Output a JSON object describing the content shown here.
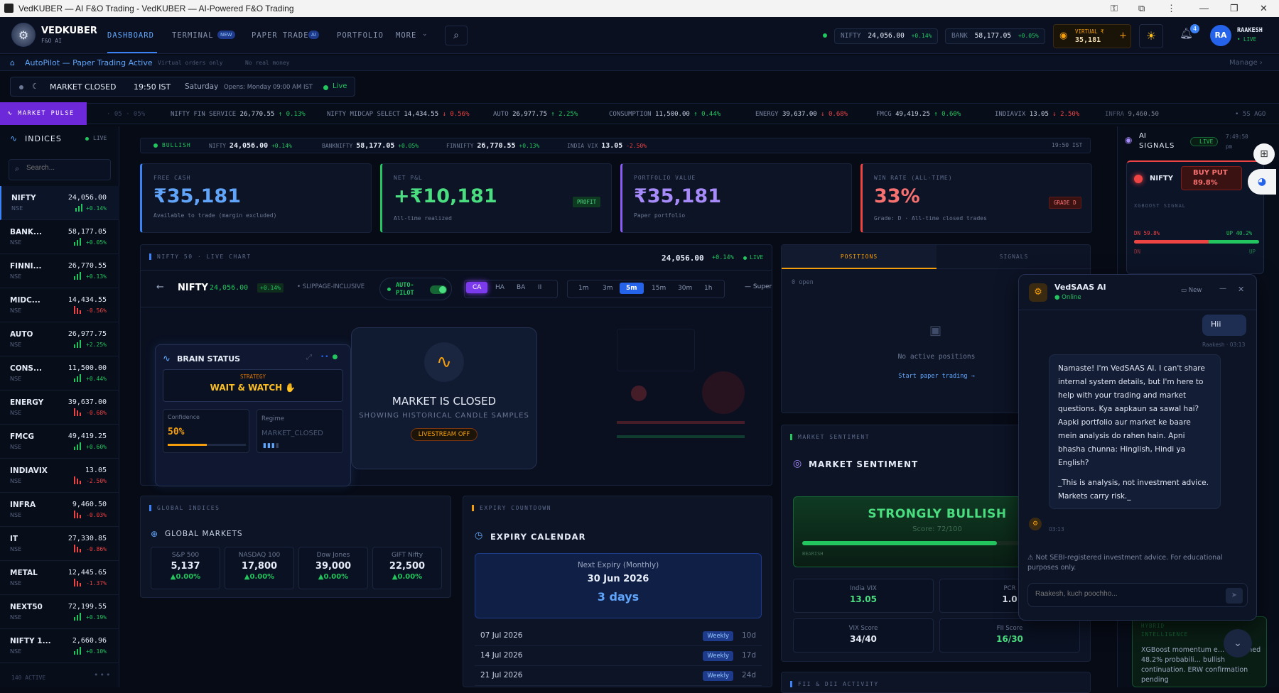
{
  "window": {
    "title": "VedKUBER — AI F&O Trading - VedKUBER — AI-Powered F&O Trading"
  },
  "brand": {
    "name": "VEDKUBER",
    "sub": "F&O AI"
  },
  "nav": {
    "links": [
      "DASHBOARD",
      "TERMINAL",
      "PAPER TRADE",
      "PORTFOLIO",
      "MORE"
    ],
    "terminal_badge": "NEW",
    "paper_badge": "AI",
    "nifty_label": "NIFTY",
    "nifty_value": "24,056.00",
    "nifty_change": "+0.14%",
    "bank_label": "BANK",
    "bank_value": "58,177.05",
    "bank_change": "+0.05%",
    "virtual_label": "VIRTUAL ₹",
    "virtual_value": "35,181",
    "notif_count": "4",
    "avatar": "RA",
    "user_name": "RAAKESH",
    "user_status": "• LIVE"
  },
  "autopilot": {
    "text": "AutoPilot — Paper Trading Active",
    "note1": "Virtual orders only",
    "note2": "No real money",
    "manage": "Manage ›"
  },
  "market_status": {
    "label": "MARKET CLOSED",
    "time": "19:50 IST",
    "day": "Saturday",
    "opens": "Opens: Monday 09:00 AM IST",
    "live": "Live"
  },
  "pulse": {
    "label": "MARKET PULSE",
    "items": [
      {
        "name": "NIFTY FIN SERVICE",
        "value": "26,770.55",
        "change": "↑ 0.13%",
        "dir": "up"
      },
      {
        "name": "NIFTY MIDCAP SELECT",
        "value": "14,434.55",
        "change": "↓ 0.56%",
        "dir": "down"
      },
      {
        "name": "AUTO",
        "value": "26,977.75",
        "change": "↑ 2.25%",
        "dir": "up"
      },
      {
        "name": "CONSUMPTION",
        "value": "11,500.00",
        "change": "↑ 0.44%",
        "dir": "up"
      },
      {
        "name": "ENERGY",
        "value": "39,637.00",
        "change": "↓ 0.68%",
        "dir": "down"
      },
      {
        "name": "FMCG",
        "value": "49,419.25",
        "change": "↑ 0.60%",
        "dir": "up"
      },
      {
        "name": "INDIAVIX",
        "value": "13.05",
        "change": "↓ 2.50%",
        "dir": "down"
      },
      {
        "name": "INFRA",
        "value": "9,460.50",
        "change": "",
        "dir": "up"
      }
    ],
    "ago": "• 5S AGO"
  },
  "indices": {
    "title": "INDICES",
    "live": "LIVE",
    "search_placeholder": "Search...",
    "rows": [
      {
        "name": "NIFTY",
        "ex": "NSE",
        "price": "24,056.00",
        "change": "+0.14%",
        "dir": "up"
      },
      {
        "name": "BANK...",
        "ex": "NSE",
        "price": "58,177.05",
        "change": "+0.05%",
        "dir": "up"
      },
      {
        "name": "FINNI...",
        "ex": "NSE",
        "price": "26,770.55",
        "change": "+0.13%",
        "dir": "up"
      },
      {
        "name": "MIDC...",
        "ex": "NSE",
        "price": "14,434.55",
        "change": "-0.56%",
        "dir": "down"
      },
      {
        "name": "AUTO",
        "ex": "NSE",
        "price": "26,977.75",
        "change": "+2.25%",
        "dir": "up"
      },
      {
        "name": "CONS...",
        "ex": "NSE",
        "price": "11,500.00",
        "change": "+0.44%",
        "dir": "up"
      },
      {
        "name": "ENERGY",
        "ex": "NSE",
        "price": "39,637.00",
        "change": "-0.68%",
        "dir": "down"
      },
      {
        "name": "FMCG",
        "ex": "NSE",
        "price": "49,419.25",
        "change": "+0.60%",
        "dir": "up"
      },
      {
        "name": "INDIAVIX",
        "ex": "NSE",
        "price": "13.05",
        "change": "-2.50%",
        "dir": "down"
      },
      {
        "name": "INFRA",
        "ex": "NSE",
        "price": "9,460.50",
        "change": "-0.03%",
        "dir": "down"
      },
      {
        "name": "IT",
        "ex": "NSE",
        "price": "27,330.85",
        "change": "-0.86%",
        "dir": "down"
      },
      {
        "name": "METAL",
        "ex": "NSE",
        "price": "12,445.65",
        "change": "-1.37%",
        "dir": "down"
      },
      {
        "name": "NEXT50",
        "ex": "NSE",
        "price": "72,199.55",
        "change": "+0.19%",
        "dir": "up"
      },
      {
        "name": "NIFTY 1...",
        "ex": "NSE",
        "price": "2,660.96",
        "change": "+0.10%",
        "dir": "up"
      }
    ],
    "footer": "140 ACTIVE"
  },
  "strip": {
    "bull": "BULLISH",
    "items": [
      {
        "name": "NIFTY",
        "value": "24,056.00",
        "change": "+0.14%",
        "dir": "up"
      },
      {
        "name": "BANKNIFTY",
        "value": "58,177.05",
        "change": "+0.05%",
        "dir": "up"
      },
      {
        "name": "FINNIFTY",
        "value": "26,770.55",
        "change": "+0.13%",
        "dir": "up"
      },
      {
        "name": "INDIA VIX",
        "value": "13.05",
        "change": "-2.50%",
        "dir": "down"
      }
    ],
    "time": "19:50 IST"
  },
  "cards": {
    "free_cash": {
      "label": "FREE CASH",
      "value": "₹35,181",
      "sub": "Available to trade (margin excluded)"
    },
    "net_pnl": {
      "label": "NET P&L",
      "value": "+₹10,181",
      "sub": "All-time realized",
      "badge": "PROFIT"
    },
    "portfolio": {
      "label": "PORTFOLIO VALUE",
      "value": "₹35,181",
      "sub": "Paper portfolio"
    },
    "win_rate": {
      "label": "WIN RATE (ALL-TIME)",
      "value": "33%",
      "sub": "Grade: D · All-time closed trades",
      "badge": "GRADE D"
    }
  },
  "chart": {
    "tag": "NIFTY 50 · LIVE CHART",
    "price": "24,056.00",
    "change": "+0.14%",
    "live": "LIVE",
    "symbol": "NIFTY",
    "sym_price": "24,056.00",
    "sym_change": "+0.14%",
    "slippage": "• SLIPPAGE-INCLUSIVE",
    "auto": "AUTO-",
    "pilot": "PILOT",
    "types": [
      "CA",
      "HA",
      "BA",
      "II"
    ],
    "tfs": [
      "1m",
      "3m",
      "5m",
      "15m",
      "30m",
      "1h"
    ],
    "super": "— Super",
    "closed_title": "MARKET IS CLOSED",
    "closed_sub": "SHOWING HISTORICAL CANDLE SAMPLES",
    "livestream": "LIVESTREAM OFF"
  },
  "brain": {
    "title": "BRAIN STATUS",
    "strategy_label": "STRATEGY",
    "strategy": "WAIT & WATCH ✋",
    "conf_label": "Confidence",
    "conf": "50%",
    "conf_fraction": 0.5,
    "regime_label": "Regime",
    "regime": "MARKET_CLOSED"
  },
  "positions": {
    "tabs": [
      "POSITIONS",
      "SIGNALS"
    ],
    "open": "0 open",
    "empty": "No active positions",
    "start": "Start paper trading →"
  },
  "sentiment": {
    "tag": "MARKET SENTIMENT",
    "title": "MARKET SENTIMENT",
    "verdict": "STRONGLY BULLISH",
    "score": "Score: 72/100",
    "score_fraction": 0.72,
    "bearish": "BEARISH",
    "stats": [
      {
        "label": "India VIX",
        "value": "13.05"
      },
      {
        "label": "PCR",
        "value": "1.0"
      },
      {
        "label": "VIX Score",
        "value": "34/40"
      },
      {
        "label": "FII Score",
        "value": "16/30"
      }
    ],
    "fii_tag": "FII & DII ACTIVITY"
  },
  "global": {
    "tag": "GLOBAL INDICES",
    "title": "GLOBAL MARKETS",
    "items": [
      {
        "name": "S&P 500",
        "value": "5,137",
        "change": "▲0.00%"
      },
      {
        "name": "NASDAQ 100",
        "value": "17,800",
        "change": "▲0.00%"
      },
      {
        "name": "Dow Jones",
        "value": "39,000",
        "change": "▲0.00%"
      },
      {
        "name": "GIFT Nifty",
        "value": "22,500",
        "change": "▲0.00%"
      }
    ]
  },
  "expiry": {
    "tag": "EXPIRY COUNTDOWN",
    "title": "EXPIRY CALENDAR",
    "next_label": "Next Expiry (Monthly)",
    "next_date": "30 Jun 2026",
    "days": "3 days",
    "rows": [
      {
        "date": "07 Jul 2026",
        "type": "Weekly",
        "days": "10d"
      },
      {
        "date": "14 Jul 2026",
        "type": "Weekly",
        "days": "17d"
      },
      {
        "date": "21 Jul 2026",
        "type": "Weekly",
        "days": "24d"
      }
    ]
  },
  "ai_signals": {
    "title1": "AI",
    "title2": "SIGNALS",
    "live": "LIVE",
    "time": "7:49:50",
    "ampm": "pm",
    "sym": "NIFTY",
    "action": "BUY PUT",
    "prob": "89.8%",
    "model": "XGBOOST SIGNAL",
    "dn": "DN 59.8%",
    "up": "UP 40.2%",
    "dn_s": "DN",
    "up_s": "UP",
    "dn_fraction": 0.598,
    "hybrid_title1": "HYBRID",
    "hybrid_title2": "INTELLIGENCE",
    "hybrid_text": "XGBoost momentum e… confirmed 48.2% probabili… bullish continuation. ERW confirmation pending"
  },
  "chat": {
    "title": "VedSAAS AI",
    "status": "Online",
    "new": "New",
    "user_msg": "Hii",
    "user_meta": "Raakesh · 03:13",
    "bot_msg": "Namaste! I'm VedSAAS AI. I can't share internal system details, but I'm here to help with your trading and market questions. Kya aapkaun sa sawal hai? Aapki portfolio aur market ke baare mein analysis do rahen hain. Apni bhasha chunna: Hinglish, Hindi ya English?",
    "bot_disclaimer": "_This is analysis, not investment advice. Markets carry risk._",
    "bot_time": "03:13",
    "warning": "⚠ Not SEBI-registered investment advice. For educational purposes only.",
    "placeholder": "Raakesh, kuch poochho..."
  },
  "colors": {
    "accent": "#3b82f6",
    "up": "#22c55e",
    "down": "#ef4444",
    "gold": "#f59e0b",
    "purple": "#8b5cf6"
  }
}
